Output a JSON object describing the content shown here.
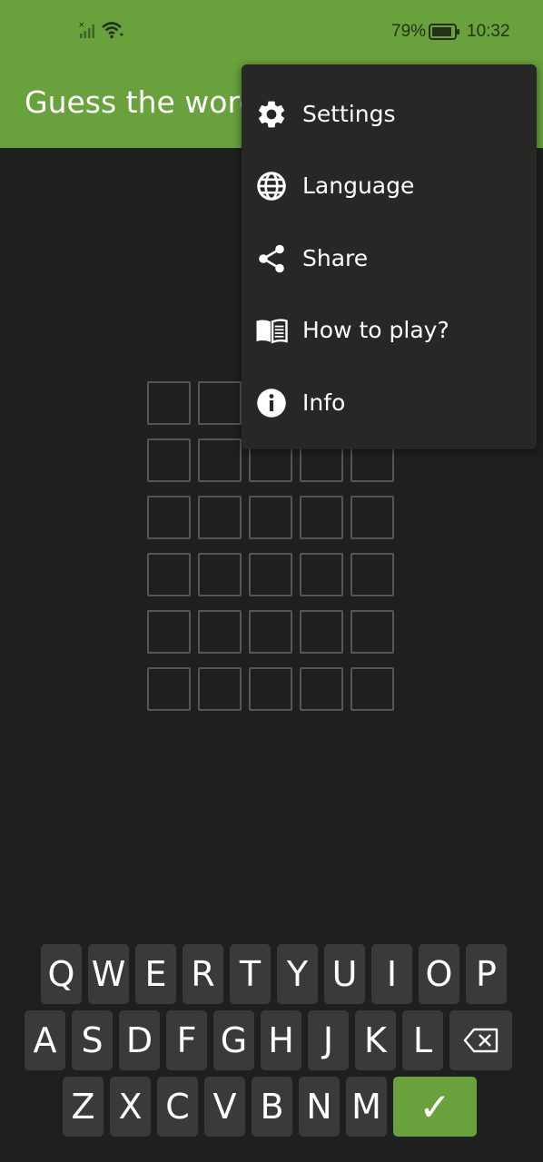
{
  "status_bar": {
    "battery_percent": "79%",
    "time": "10:32"
  },
  "app_bar": {
    "title": "Guess the word"
  },
  "grid": {
    "rows": 6,
    "cols": 5
  },
  "keyboard": {
    "row1": [
      "Q",
      "W",
      "E",
      "R",
      "T",
      "Y",
      "U",
      "I",
      "O",
      "P"
    ],
    "row2": [
      "A",
      "S",
      "D",
      "F",
      "G",
      "H",
      "J",
      "K",
      "L"
    ],
    "row3": [
      "Z",
      "X",
      "C",
      "V",
      "B",
      "N",
      "M"
    ],
    "delete_icon": "backspace-icon",
    "enter_label": "✓"
  },
  "menu": {
    "items": [
      {
        "label": "Settings",
        "icon": "gear-icon"
      },
      {
        "label": "Language",
        "icon": "globe-icon"
      },
      {
        "label": "Share",
        "icon": "share-icon"
      },
      {
        "label": "How to play?",
        "icon": "book-icon"
      },
      {
        "label": "Info",
        "icon": "info-icon"
      }
    ]
  },
  "colors": {
    "accent": "#69a23c",
    "background": "#1f1f22",
    "key": "#3a3a3c",
    "menu": "#272726"
  }
}
